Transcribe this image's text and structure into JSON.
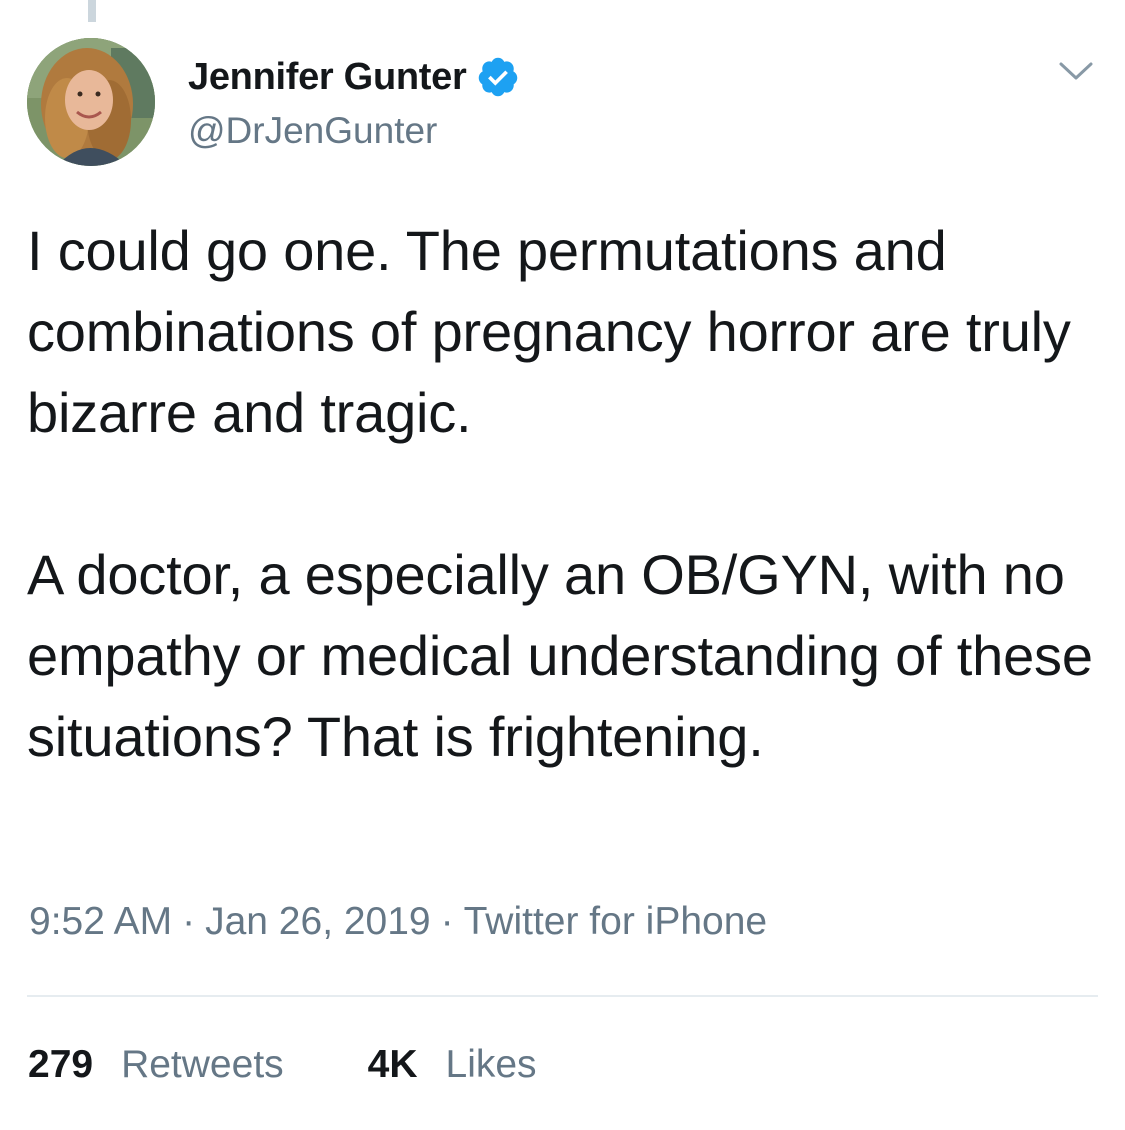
{
  "author": {
    "display_name": "Jennifer Gunter",
    "handle": "@DrJenGunter",
    "verified": true
  },
  "tweet": {
    "paragraphs": [
      "I could go one. The permutations and combinations of pregnancy horror are truly bizarre and tragic.",
      "A doctor, a especially an OB/GYN, with no empathy or medical understanding of these situations? That is frightening."
    ]
  },
  "meta": {
    "time": "9:52 AM",
    "separator": "·",
    "date": "Jan 26, 2019",
    "source": "Twitter for iPhone"
  },
  "stats": {
    "retweets_count": "279",
    "retweets_label": "Retweets",
    "likes_count": "4K",
    "likes_label": "Likes"
  },
  "colors": {
    "text_primary": "#14171a",
    "text_secondary": "#657786",
    "verified_blue": "#1da1f2",
    "divider": "#e6ecf0"
  },
  "icons": {
    "verified": "verified-badge-icon",
    "caret": "chevron-down-icon"
  }
}
